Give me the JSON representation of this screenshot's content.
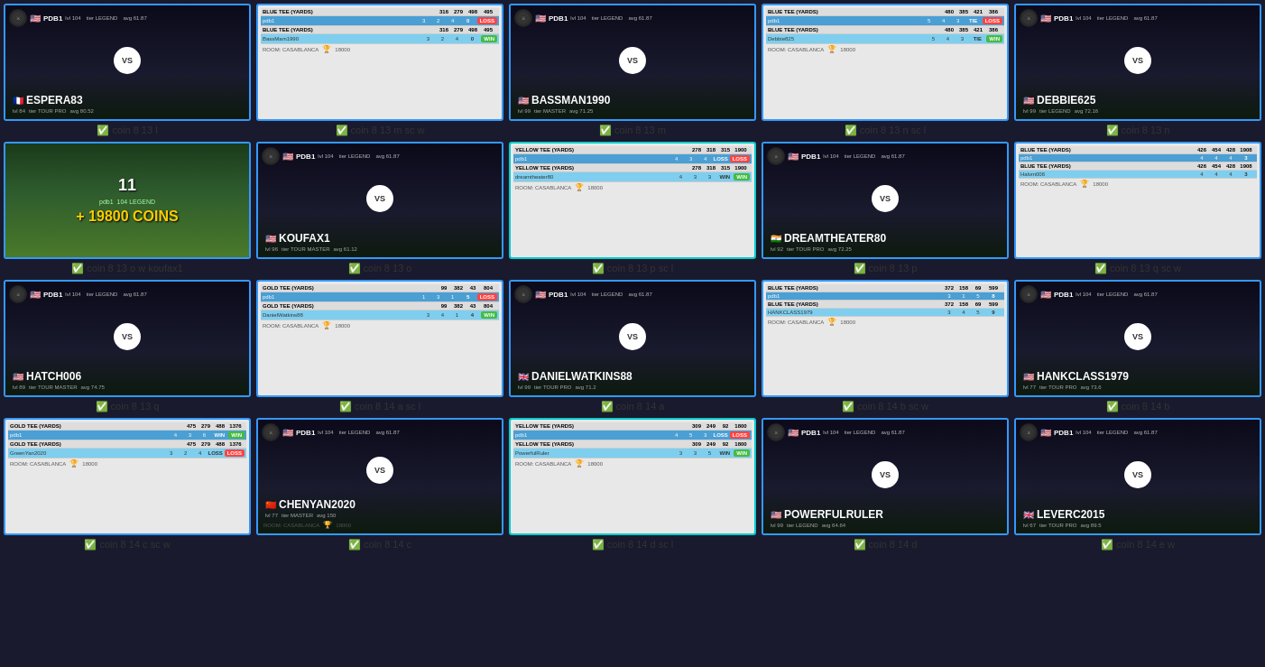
{
  "cards": [
    {
      "id": "card1",
      "type": "vs",
      "border": "blue",
      "pdb1": {
        "flag": "🇺🇸",
        "name": "PDB1",
        "lvl": "104",
        "tier": "LEGEND",
        "avg": "61.87"
      },
      "opponent": {
        "flag": "🇫🇷",
        "name": "ESPERA83",
        "lvl": "84",
        "tier": "TOUR PRO",
        "avg": "80.52"
      },
      "label": "✅ coin 8 13 l"
    },
    {
      "id": "card2",
      "type": "scorecard",
      "border": "blue",
      "room": "CASABLANCA",
      "prize": "18000",
      "rows": [
        {
          "name": "BLUE TEE (YARDS)",
          "scores": [
            "316",
            "279",
            "498"
          ],
          "total": "495",
          "result": ""
        },
        {
          "name": "pdb1",
          "scores": [
            "3",
            "2",
            "4"
          ],
          "total": "0",
          "result": "LOSS",
          "style": "player"
        },
        {
          "name": "BLUE TEE (YARDS)",
          "scores": [
            "316",
            "279",
            "498"
          ],
          "total": "495",
          "result": ""
        },
        {
          "name": "BassMam1990",
          "scores": [
            "3",
            "2",
            "4"
          ],
          "total": "0",
          "result": "WIN",
          "style": "alt"
        }
      ],
      "label": "✅ coin 8 13 m sc w"
    },
    {
      "id": "card3",
      "type": "vs",
      "border": "blue",
      "pdb1": {
        "flag": "🇺🇸",
        "name": "PDB1",
        "lvl": "104",
        "tier": "LEGEND",
        "avg": "61.87"
      },
      "opponent": {
        "flag": "🇺🇸",
        "name": "BASSMAN1990",
        "lvl": "99",
        "tier": "MASTER",
        "avg": "71.25"
      },
      "label": "✅ coin 8 13 m"
    },
    {
      "id": "card4",
      "type": "scorecard",
      "border": "blue",
      "room": "CASABLANCA",
      "prize": "18000",
      "rows": [
        {
          "name": "BLUE TEE (YARDS)",
          "scores": [
            "480",
            "385",
            "421"
          ],
          "total": "386",
          "result": ""
        },
        {
          "name": "pdb1",
          "scores": [
            "5",
            "4",
            "3"
          ],
          "total": "TIE",
          "result": "LOSS",
          "style": "player"
        },
        {
          "name": "BLUE TEE (YARDS)",
          "scores": [
            "480",
            "385",
            "421"
          ],
          "total": "386",
          "result": ""
        },
        {
          "name": "Debbie825",
          "scores": [
            "5",
            "4",
            "3"
          ],
          "total": "TIE",
          "result": "WIN",
          "style": "alt"
        }
      ],
      "label": "✅ coin 8 13 n sc l"
    },
    {
      "id": "card5",
      "type": "vs",
      "border": "blue",
      "pdb1": {
        "flag": "🇺🇸",
        "name": "PDB1",
        "lvl": "104",
        "tier": "LEGEND",
        "avg": "61.87"
      },
      "opponent": {
        "flag": "🇺🇸",
        "name": "DEBBIE625",
        "lvl": "99",
        "tier": "LEGEND",
        "avg": "72.16"
      },
      "label": "✅ coin 8 13 n"
    },
    {
      "id": "card6",
      "type": "coins",
      "border": "blue",
      "number": "11",
      "player": "pdb1",
      "lvl": "104",
      "tier": "LEGEND",
      "coins": "+ 19800 COINS",
      "label": "✅ coin 8 13 o w koufax1"
    },
    {
      "id": "card7",
      "type": "vs",
      "border": "blue",
      "pdb1": {
        "flag": "🇺🇸",
        "name": "PDB1",
        "lvl": "104",
        "tier": "LEGEND",
        "avg": "61.87"
      },
      "opponent": {
        "flag": "🇺🇸",
        "name": "KOUFAX1",
        "lvl": "96",
        "tier": "TOUR MASTER",
        "avg": "61.12"
      },
      "label": "✅ coin 8 13 o"
    },
    {
      "id": "card8",
      "type": "scorecard",
      "border": "cyan",
      "room": "CASABLANCA",
      "prize": "18000",
      "rows": [
        {
          "name": "YELLOW TEE (YARDS)",
          "scores": [
            "278",
            "318",
            "315"
          ],
          "total": "1900",
          "result": ""
        },
        {
          "name": "pdb1",
          "scores": [
            "4",
            "3",
            "4"
          ],
          "total": "LOSS",
          "result": "LOSS",
          "style": "player"
        },
        {
          "name": "YELLOW TEE (YARDS)",
          "scores": [
            "278",
            "318",
            "315"
          ],
          "total": "1900",
          "result": ""
        },
        {
          "name": "dreamtheater80",
          "scores": [
            "4",
            "3",
            "3"
          ],
          "total": "WIN",
          "result": "WIN",
          "style": "alt"
        }
      ],
      "label": "✅ coin 8 13 p sc l"
    },
    {
      "id": "card9",
      "type": "vs",
      "border": "blue",
      "pdb1": {
        "flag": "🇺🇸",
        "name": "PDB1",
        "lvl": "104",
        "tier": "LEGEND",
        "avg": "61.87"
      },
      "opponent": {
        "flag": "🇮🇳",
        "name": "DREAMTHEATER80",
        "lvl": "92",
        "tier": "TOUR PRO",
        "avg": "72.25"
      },
      "label": "✅ coin 8 13 p"
    },
    {
      "id": "card10",
      "type": "scorecard",
      "border": "blue",
      "room": "CASABLANCA",
      "prize": "18000",
      "rows": [
        {
          "name": "BLUE TEE (YARDS)",
          "scores": [
            "426",
            "454",
            "428"
          ],
          "total": "1908",
          "result": ""
        },
        {
          "name": "pdb1",
          "scores": [
            "4",
            "4",
            "4"
          ],
          "total": "3",
          "result": "",
          "style": "player"
        },
        {
          "name": "BLUE TEE (YARDS)",
          "scores": [
            "426",
            "454",
            "428"
          ],
          "total": "1908",
          "result": ""
        },
        {
          "name": "Halvm006",
          "scores": [
            "4",
            "4",
            "4"
          ],
          "total": "3",
          "result": "",
          "style": "alt"
        }
      ],
      "label": "✅ coin 8 13 q sc w"
    },
    {
      "id": "card11",
      "type": "vs",
      "border": "blue",
      "pdb1": {
        "flag": "🇺🇸",
        "name": "PDB1",
        "lvl": "104",
        "tier": "LEGEND",
        "avg": "61.87"
      },
      "opponent": {
        "flag": "🇺🇸",
        "name": "HATCH006",
        "lvl": "89",
        "tier": "TOUR MASTER",
        "avg": "74.75"
      },
      "label": "✅ coin 8 13 q"
    },
    {
      "id": "card12",
      "type": "scorecard",
      "border": "blue",
      "room": "CASABLANCA",
      "prize": "18000",
      "rows": [
        {
          "name": "GOLD TEE (YARDS)",
          "scores": [
            "99",
            "382",
            "43"
          ],
          "total": "804",
          "result": ""
        },
        {
          "name": "pdb1",
          "scores": [
            "1",
            "3",
            "1"
          ],
          "total": "5",
          "result": "LOSS",
          "style": "player"
        },
        {
          "name": "GOLD TEE (YARDS)",
          "scores": [
            "99",
            "382",
            "43"
          ],
          "total": "804",
          "result": ""
        },
        {
          "name": "DanielWatkins88",
          "scores": [
            "3",
            "4",
            "1"
          ],
          "total": "4",
          "result": "WIN",
          "style": "alt"
        }
      ],
      "label": "✅ coin 8 14 a sc l"
    },
    {
      "id": "card13",
      "type": "vs",
      "border": "blue",
      "pdb1": {
        "flag": "🇺🇸",
        "name": "PDB1",
        "lvl": "104",
        "tier": "LEGEND",
        "avg": "61.87"
      },
      "opponent": {
        "flag": "🇬🇧",
        "name": "DANIELWATKINS88",
        "lvl": "99",
        "tier": "TOUR PRO",
        "avg": "71.2"
      },
      "label": "✅ coin 8 14 a"
    },
    {
      "id": "card14",
      "type": "scorecard",
      "border": "blue",
      "room": "CASABLANCA",
      "prize": "18000",
      "rows": [
        {
          "name": "BLUE TEE (YARDS)",
          "scores": [
            "372",
            "158",
            "69"
          ],
          "total": "599",
          "result": ""
        },
        {
          "name": "pdb1",
          "scores": [
            "3",
            "1",
            "5"
          ],
          "total": "8",
          "result": "",
          "style": "player"
        },
        {
          "name": "BLUE TEE (YARDS)",
          "scores": [
            "372",
            "158",
            "69"
          ],
          "total": "599",
          "result": ""
        },
        {
          "name": "HANKCLASS1979",
          "scores": [
            "3",
            "4",
            "5"
          ],
          "total": "9",
          "result": "",
          "style": "alt"
        }
      ],
      "label": "✅ coin 8 14 b sc w"
    },
    {
      "id": "card15",
      "type": "vs",
      "border": "blue",
      "pdb1": {
        "flag": "🇺🇸",
        "name": "PDB1",
        "lvl": "104",
        "tier": "LEGEND",
        "avg": "61.87"
      },
      "opponent": {
        "flag": "🇺🇸",
        "name": "HANKCLASS1979",
        "lvl": "77",
        "tier": "TOUR PRO",
        "avg": "73.6"
      },
      "label": "✅ coin 8 14 b"
    },
    {
      "id": "card16",
      "type": "scorecard",
      "border": "blue",
      "room": "CASABLANCA",
      "prize": "18000",
      "rows": [
        {
          "name": "GOLD TEE (YARDS)",
          "scores": [
            "475",
            "279",
            "488"
          ],
          "total": "1376",
          "result": ""
        },
        {
          "name": "pdb1",
          "scores": [
            "4",
            "3",
            "6"
          ],
          "total": "WIN",
          "result": "WIN",
          "style": "player"
        },
        {
          "name": "GOLD TEE (YARDS)",
          "scores": [
            "475",
            "279",
            "488"
          ],
          "total": "1376",
          "result": ""
        },
        {
          "name": "GreenYan2020",
          "scores": [
            "3",
            "2",
            "4"
          ],
          "total": "LOSS",
          "result": "LOSS",
          "style": "alt"
        }
      ],
      "label": "✅ coin 8 14 c sc w"
    },
    {
      "id": "card17",
      "type": "vs",
      "border": "blue",
      "pdb1": {
        "flag": "🇺🇸",
        "name": "PDB1",
        "lvl": "104",
        "tier": "LEGEND",
        "avg": "61.87"
      },
      "opponent": {
        "flag": "🇨🇳",
        "name": "CHENYAN2020",
        "lvl": "77",
        "tier": "MASTER",
        "avg": "150"
      },
      "room": "CASABLANCA",
      "prize": "18000",
      "label": "✅ coin 8 14 c"
    },
    {
      "id": "card18",
      "type": "scorecard",
      "border": "cyan",
      "room": "CASABLANCA",
      "prize": "18000",
      "rows": [
        {
          "name": "YELLOW TEE (YARDS)",
          "scores": [
            "309",
            "249",
            "92"
          ],
          "total": "1800",
          "result": ""
        },
        {
          "name": "pdb1",
          "scores": [
            "4",
            "5",
            "3"
          ],
          "total": "LOSS",
          "result": "LOSS",
          "style": "player"
        },
        {
          "name": "YELLOW TEE (YARDS)",
          "scores": [
            "309",
            "249",
            "92"
          ],
          "total": "1800",
          "result": ""
        },
        {
          "name": "PowerfulRuler",
          "scores": [
            "3",
            "3",
            "5"
          ],
          "total": "WIN",
          "result": "WIN",
          "style": "alt"
        }
      ],
      "label": "✅ coin 8 14 d sc l"
    },
    {
      "id": "card19",
      "type": "vs",
      "border": "blue",
      "pdb1": {
        "flag": "🇺🇸",
        "name": "PDB1",
        "lvl": "104",
        "tier": "LEGEND",
        "avg": "61.87"
      },
      "opponent": {
        "flag": "🇺🇸",
        "name": "POWERFULRULER",
        "lvl": "99",
        "tier": "LEGEND",
        "avg": "64.64"
      },
      "label": "✅ coin 8 14 d"
    },
    {
      "id": "card20",
      "type": "vs",
      "border": "blue",
      "pdb1": {
        "flag": "🇺🇸",
        "name": "PDB1",
        "lvl": "104",
        "tier": "LEGEND",
        "avg": "61.87"
      },
      "opponent": {
        "flag": "🇬🇧",
        "name": "LEVERC2015",
        "lvl": "67",
        "tier": "TOUR PRO",
        "avg": "89.5"
      },
      "label": "✅ coin 8 14 e w"
    }
  ]
}
